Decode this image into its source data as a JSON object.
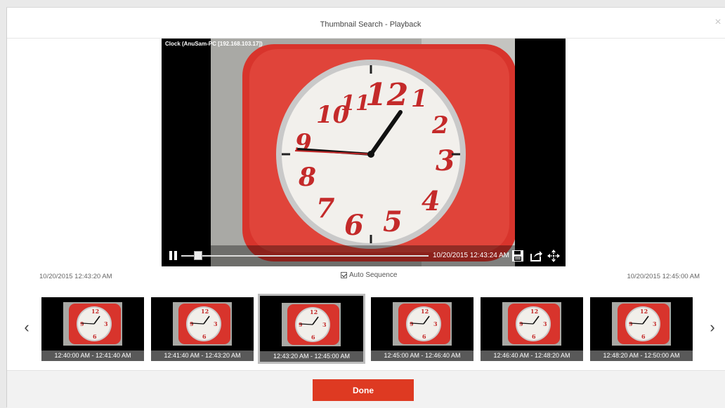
{
  "dialog": {
    "title": "Thumbnail Search - Playback",
    "close_glyph": "×"
  },
  "player": {
    "camera_label": "Clock (AnuSam-PC [192.168.103.17])",
    "timestamp": "10/20/2015 12:43:24 AM",
    "progress": 0.05,
    "icons": [
      "pause-icon",
      "save-icon",
      "export-icon",
      "move-icon"
    ]
  },
  "range": {
    "start": "10/20/2015 12:43:20 AM",
    "end": "10/20/2015 12:45:00 AM",
    "auto_sequence_label": "Auto Sequence",
    "auto_sequence_checked": true
  },
  "thumbnails": [
    {
      "caption": "12:40:00 AM - 12:41:40 AM",
      "selected": false
    },
    {
      "caption": "12:41:40 AM - 12:43:20 AM",
      "selected": false
    },
    {
      "caption": "12:43:20 AM - 12:45:00 AM",
      "selected": true
    },
    {
      "caption": "12:45:00 AM - 12:46:40 AM",
      "selected": false
    },
    {
      "caption": "12:46:40 AM - 12:48:20 AM",
      "selected": false
    },
    {
      "caption": "12:48:20 AM - 12:50:00 AM",
      "selected": false
    }
  ],
  "nav": {
    "prev_glyph": "‹",
    "next_glyph": "›"
  },
  "footer": {
    "done_label": "Done"
  },
  "colors": {
    "accent": "#de3a22",
    "clock_red": "#d8342c",
    "caption_bg": "#595959"
  }
}
